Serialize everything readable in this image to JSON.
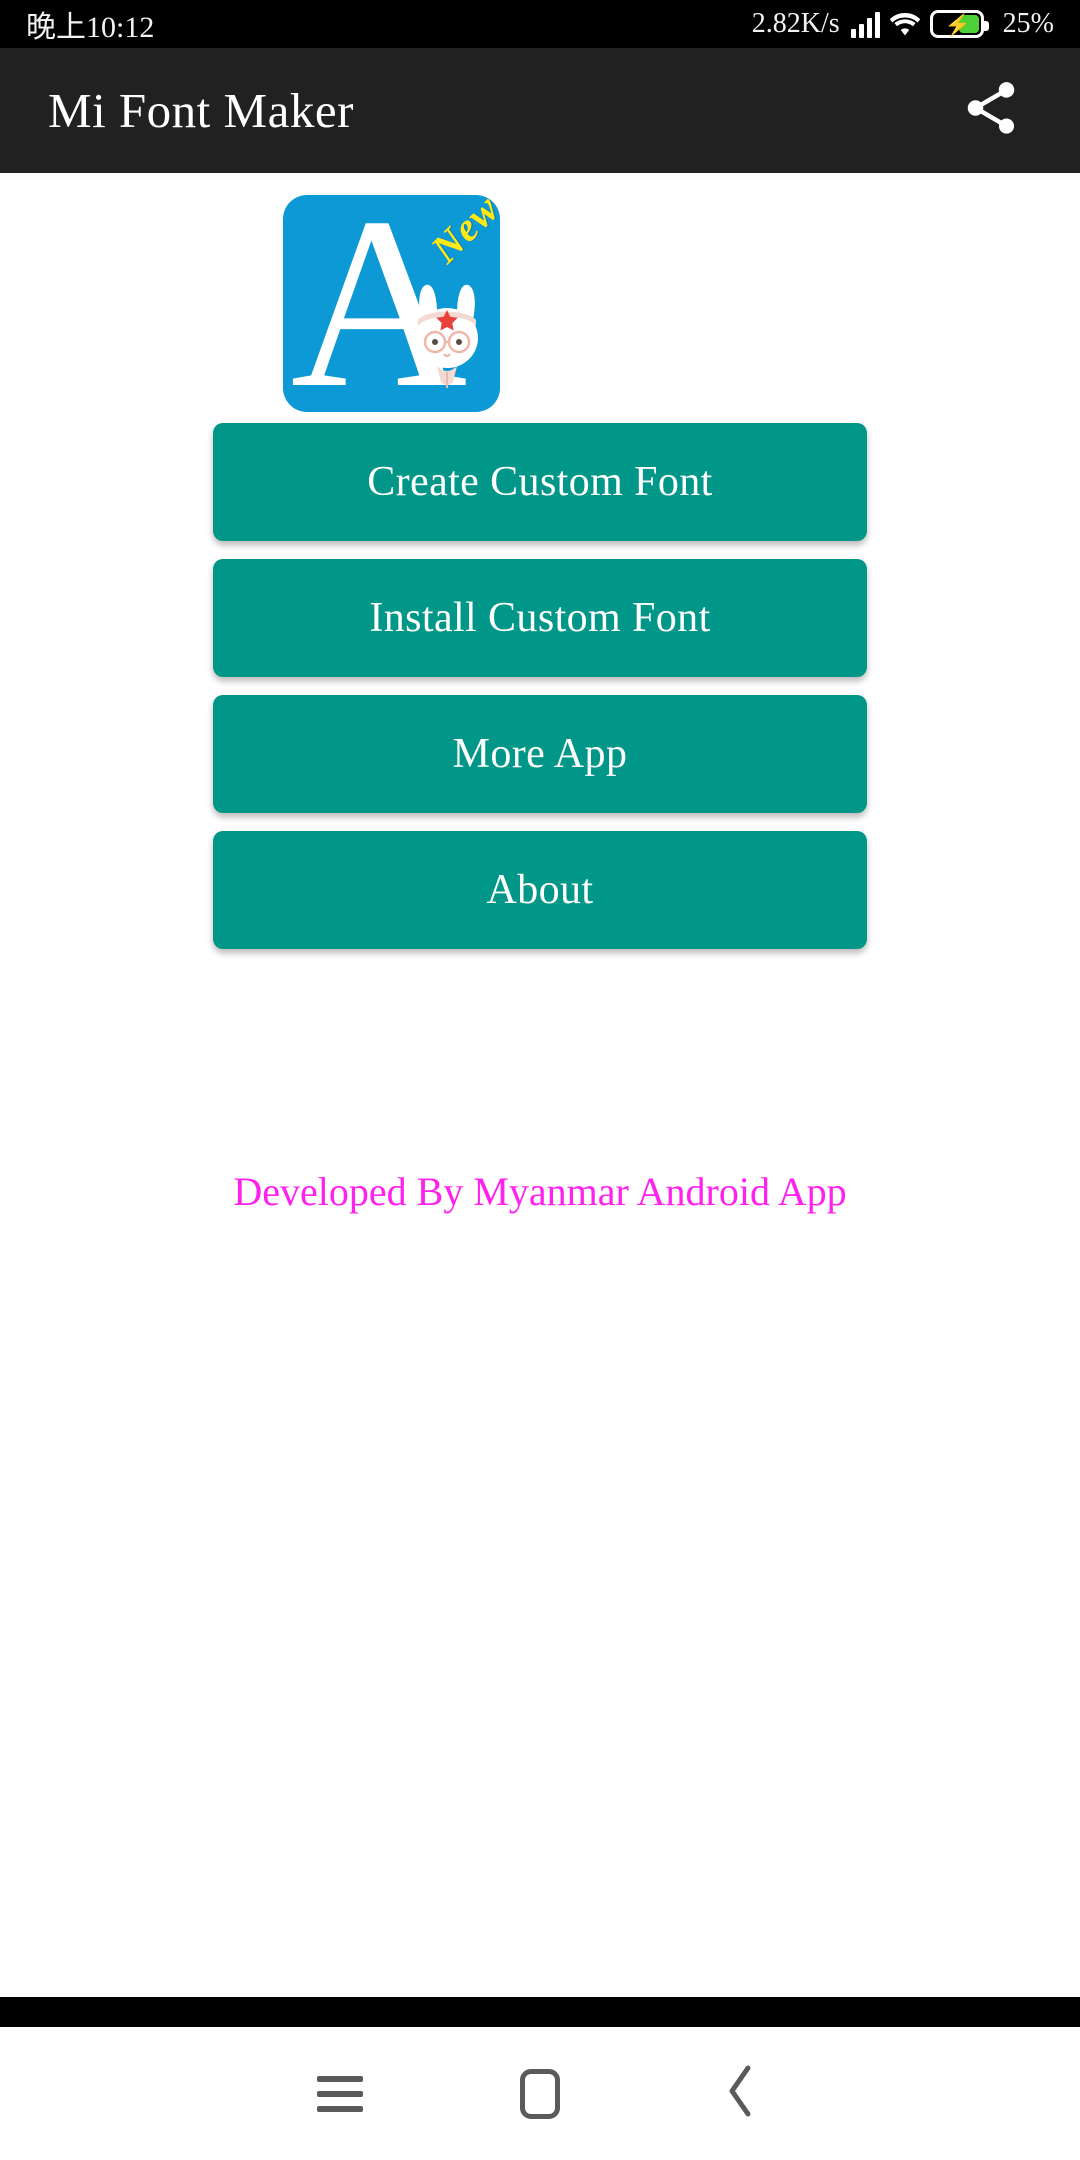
{
  "status_bar": {
    "time": "晚上10:12",
    "network_speed": "2.82K/s",
    "battery_percent": "25%",
    "signal_icon": "signal-bars-icon",
    "wifi_icon": "wifi-icon",
    "battery_icon": "battery-charging-icon"
  },
  "app_bar": {
    "title": "Mi Font Maker",
    "share_icon": "share-icon",
    "background_color": "#212121"
  },
  "logo": {
    "letter": "A",
    "badge": "New",
    "badge_color": "#ffe813",
    "background_color": "#0d99d6",
    "mascot_icon": "mi-bunny-mascot-icon"
  },
  "buttons": [
    {
      "label": "Create Custom Font",
      "name": "create-custom-font-button"
    },
    {
      "label": "Install Custom Font",
      "name": "install-custom-font-button"
    },
    {
      "label": "More App",
      "name": "more-app-button"
    },
    {
      "label": "About",
      "name": "about-button"
    }
  ],
  "credit": {
    "text": "Developed By Myanmar Android App",
    "color": "#ff22ee"
  },
  "nav_bar": {
    "menu_icon": "menu-icon",
    "home_icon": "home-icon",
    "back_icon": "back-icon",
    "back_glyph": "‹"
  },
  "theme": {
    "button_color": "#009688",
    "page_background": "#ffffff"
  }
}
